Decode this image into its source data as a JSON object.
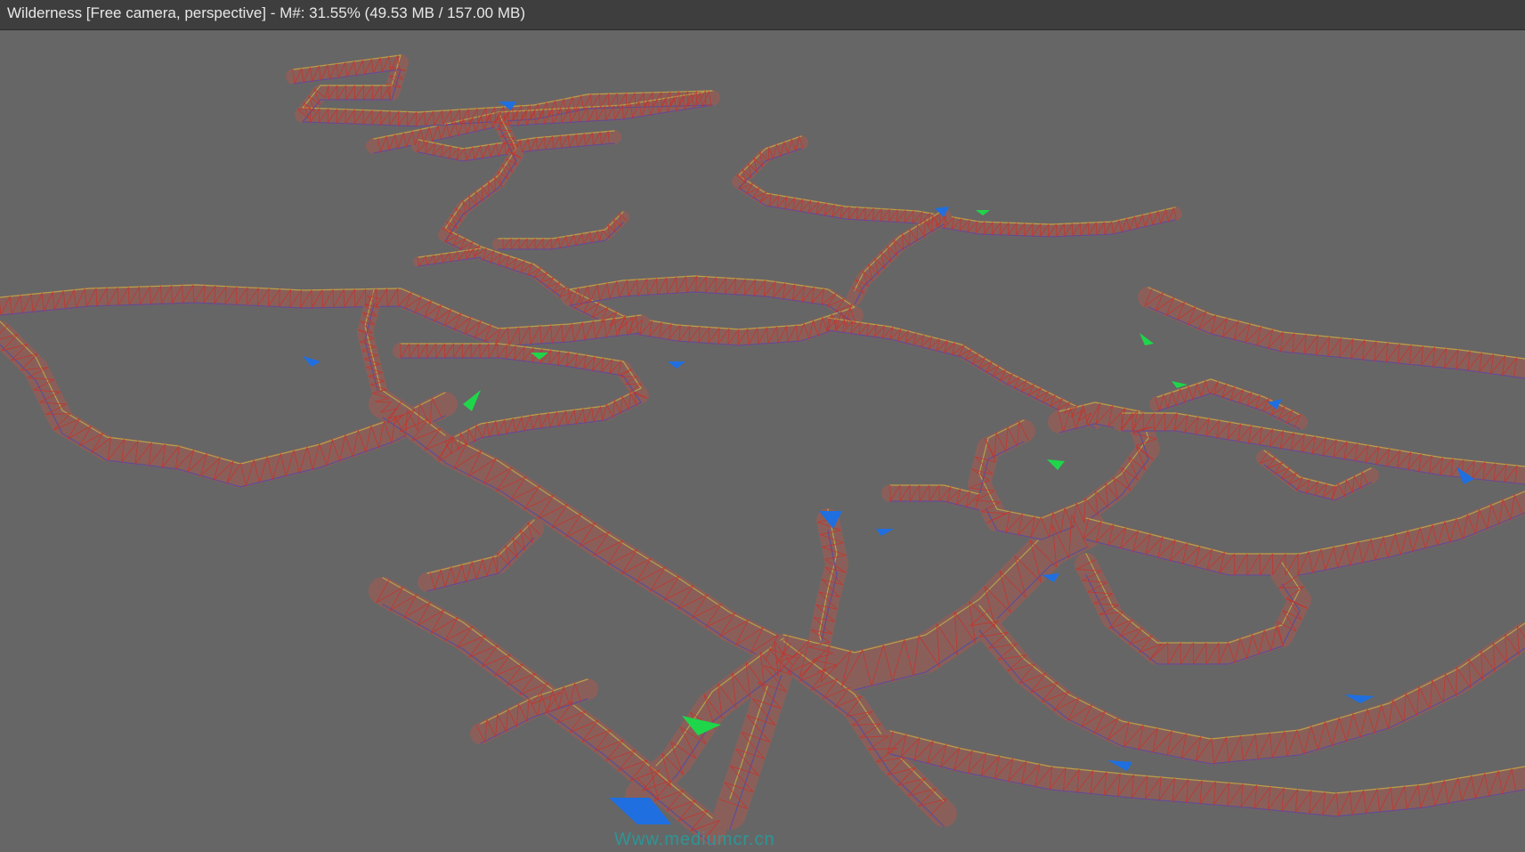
{
  "window": {
    "title": "Wilderness [Free camera, perspective] - M#: 31.55% (49.53 MB / 157.00 MB)"
  },
  "viewport": {
    "scene_name": "Wilderness",
    "camera_mode": "Free camera, perspective",
    "memory_percent": "31.55%",
    "memory_used": "49.53 MB",
    "memory_total": "157.00 MB",
    "watermark": "Www.mediumcr.cn",
    "colors": {
      "background": "#666666",
      "road_fill": "#8a5f5a",
      "mesh_lines": "#c8322a",
      "edge_yellow": "#b4a24a",
      "edge_purple": "#5a4f99",
      "marker_blue": "#1f6fe0",
      "marker_green": "#1fd64a"
    }
  }
}
